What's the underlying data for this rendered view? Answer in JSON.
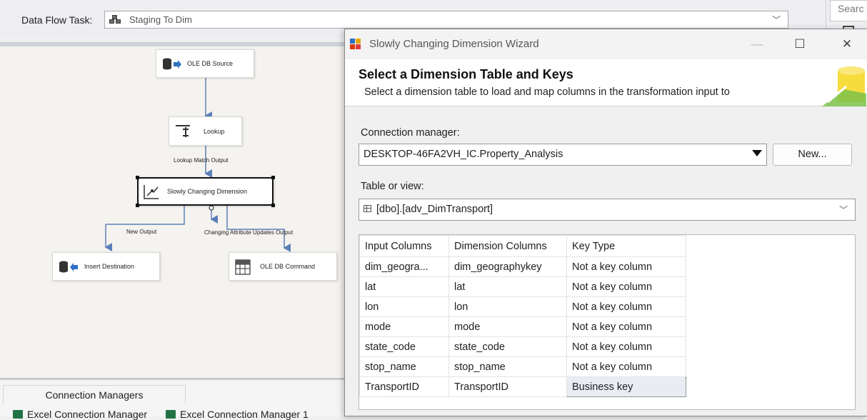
{
  "task_bar": {
    "label": "Data Flow Task:",
    "selected_task": "Staging To Dim",
    "search_placeholder": "Searc"
  },
  "canvas": {
    "nodes": {
      "ole_db_source": "OLE DB Source",
      "lookup": "Lookup",
      "scd": "Slowly Changing Dimension",
      "insert_destination": "Insert Destination",
      "ole_db_command": "OLE DB Command"
    },
    "paths": {
      "lookup_match_output": "Lookup Match Output",
      "new_output": "New Output",
      "changing_attribute_updates_output": "Changing Attribute Updates Output"
    }
  },
  "connection_managers": {
    "tab_label": "Connection Managers",
    "items": [
      "Excel Connection Manager",
      "Excel Connection Manager 1"
    ]
  },
  "wizard": {
    "window_title": "Slowly Changing Dimension Wizard",
    "header_title": "Select a Dimension Table and Keys",
    "header_subtitle": "Select a dimension table to load and map columns in the transformation input to",
    "connection_manager_label": "Connection manager:",
    "connection_manager_value": "DESKTOP-46FA2VH_IC.Property_Analysis",
    "new_button_label": "New...",
    "table_label": "Table or view:",
    "table_value": "[dbo].[adv_DimTransport]",
    "columns": {
      "headers": [
        "Input Columns",
        "Dimension Columns",
        "Key Type"
      ],
      "rows": [
        [
          "dim_geogra...",
          "dim_geographykey",
          "Not a key column"
        ],
        [
          "lat",
          "lat",
          "Not a key column"
        ],
        [
          "lon",
          "lon",
          "Not a key column"
        ],
        [
          "mode",
          "mode",
          "Not a key column"
        ],
        [
          "state_code",
          "state_code",
          "Not a key column"
        ],
        [
          "stop_name",
          "stop_name",
          "Not a key column"
        ],
        [
          "TransportID",
          "TransportID",
          "Business key"
        ]
      ]
    }
  },
  "colors": {
    "canvas_bg": "#f5f3ef",
    "path_line": "#5b7fb6",
    "wizard_bg": "#f0f0f0"
  }
}
